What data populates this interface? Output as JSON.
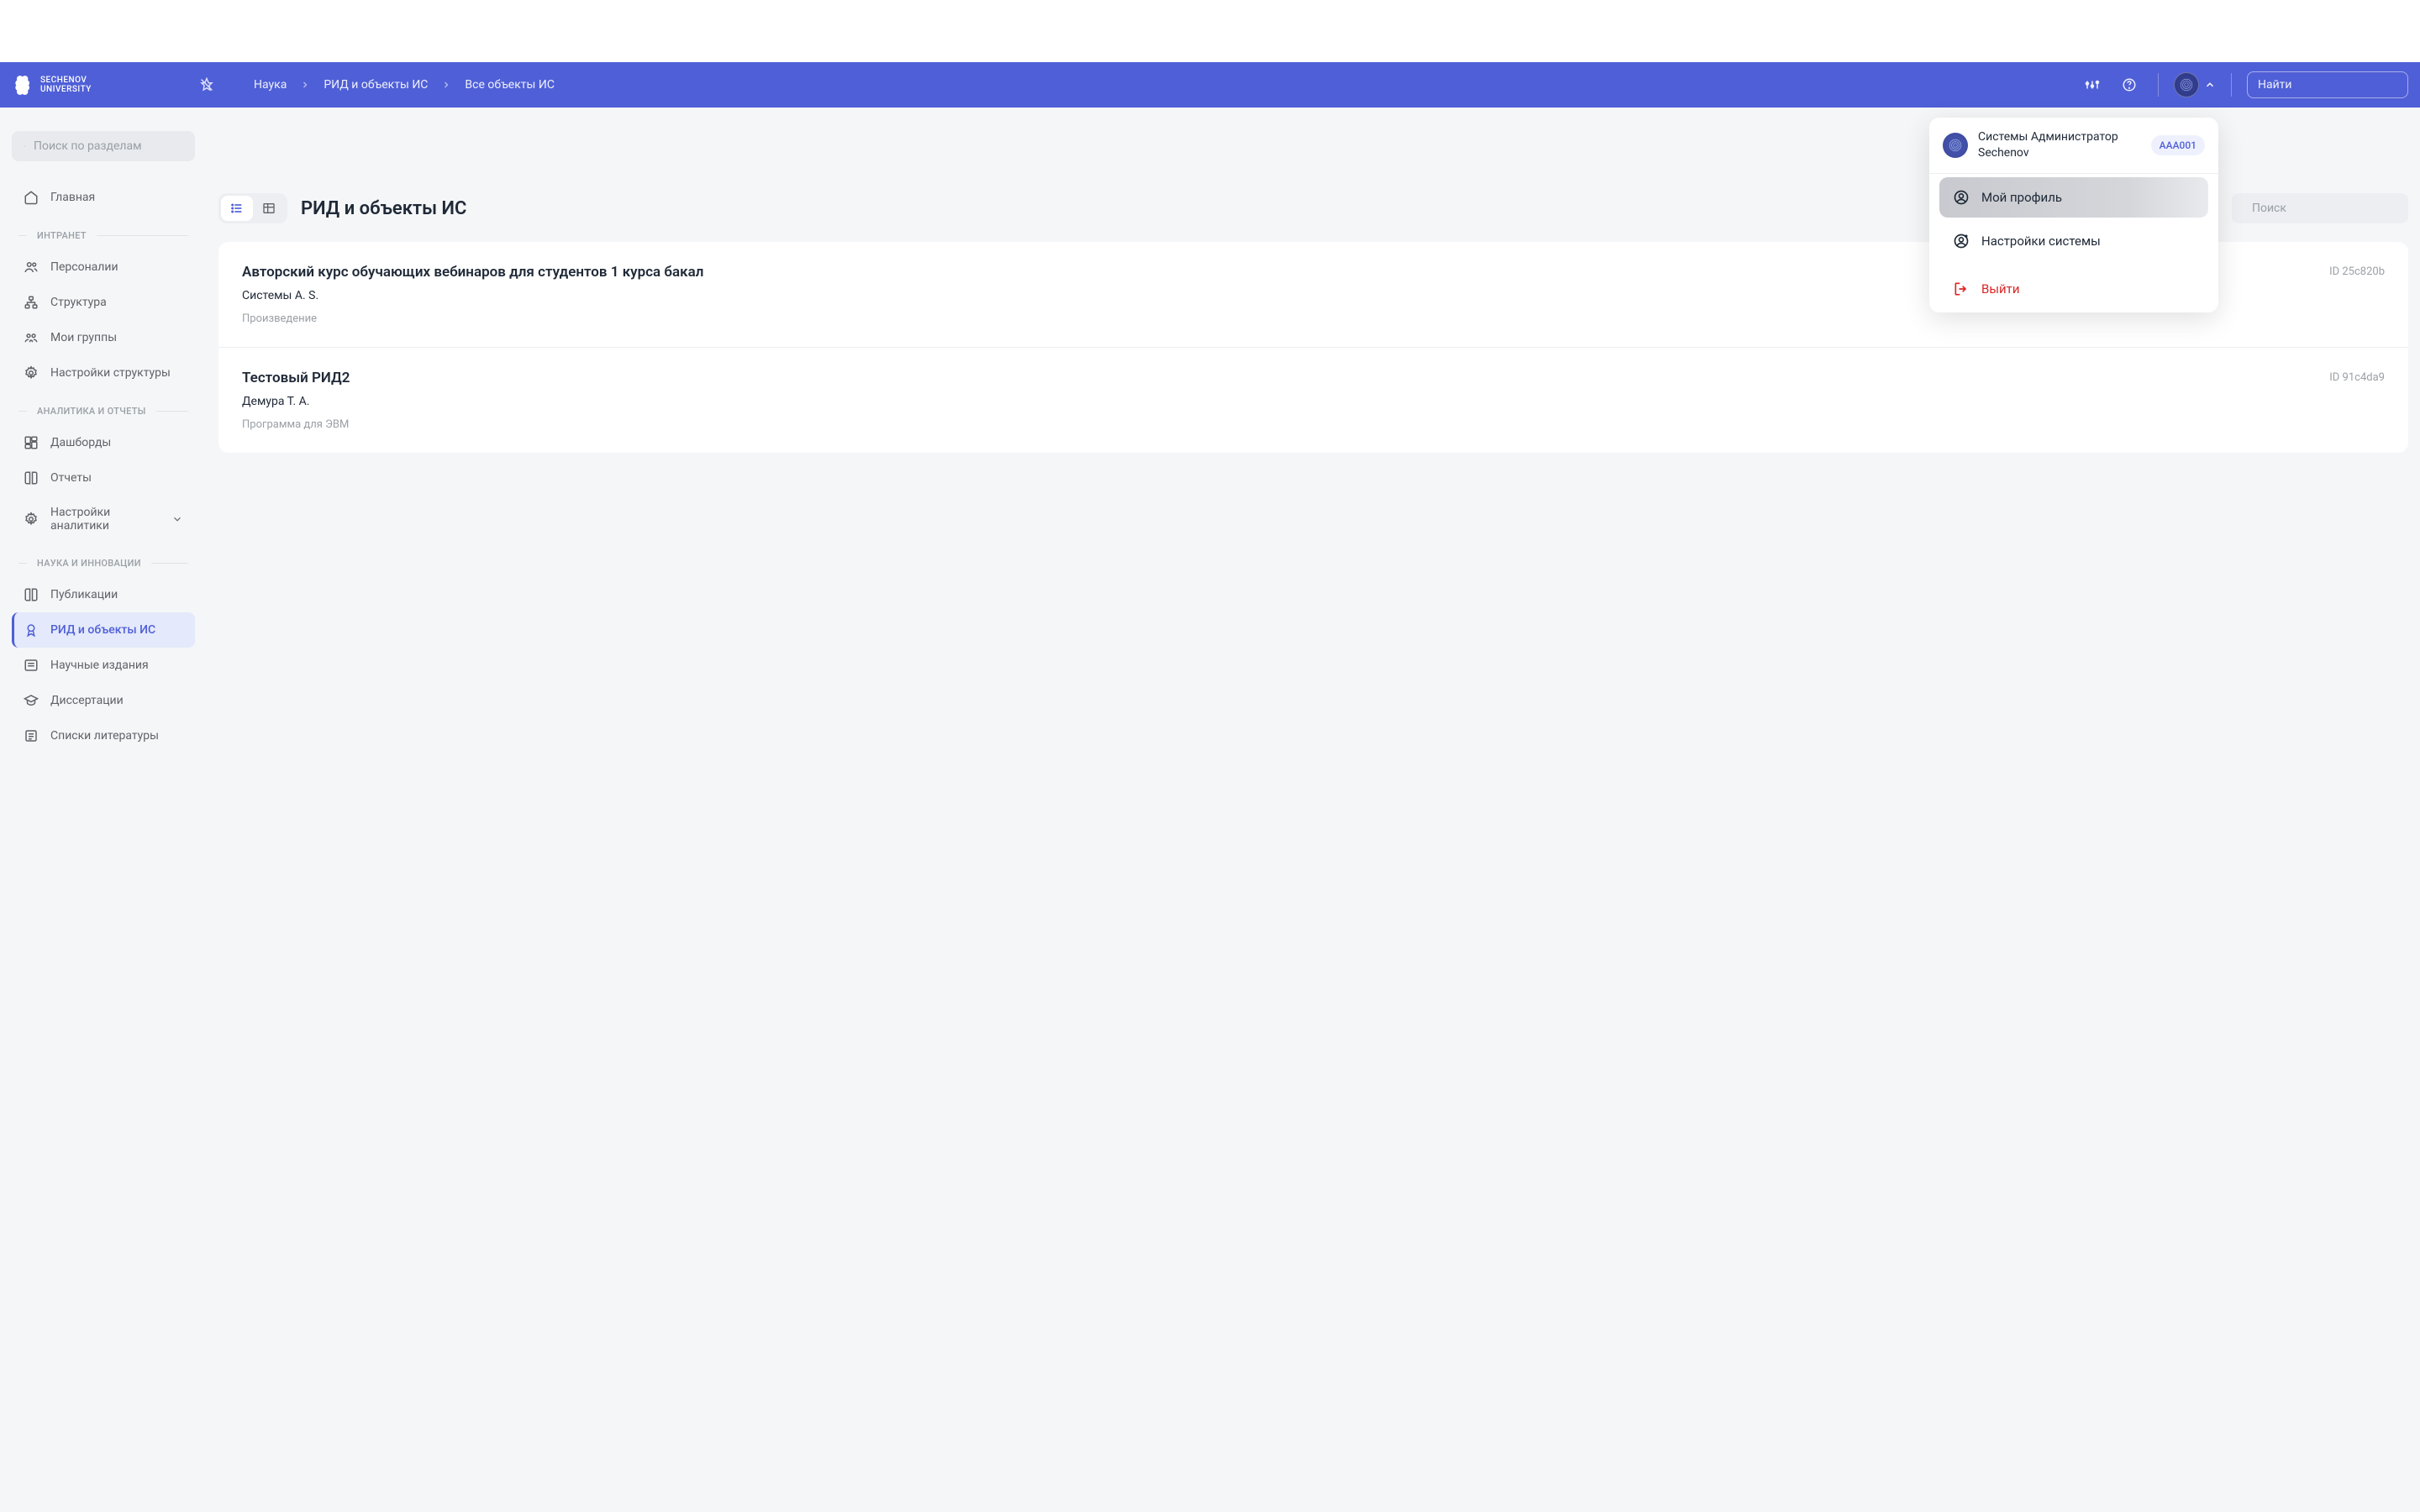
{
  "brand": {
    "line1": "SECHENOV",
    "line2": "UNIVERSITY"
  },
  "breadcrumb": {
    "a": "Наука",
    "b": "РИД и объекты ИС",
    "c": "Все объекты ИС"
  },
  "topsearch": {
    "placeholder": "Найти"
  },
  "sidebar": {
    "search_placeholder": "Поиск по разделам",
    "home": "Главная",
    "sec_intranet": "ИНТРАНЕТ",
    "personalii": "Персоналии",
    "struktura": "Структура",
    "groups": "Мои группы",
    "struct_settings": "Настройки структуры",
    "sec_analytics": "АНАЛИТИКА И ОТЧЕТЫ",
    "dashboards": "Дашборды",
    "reports": "Отчеты",
    "analytics_settings": "Настройки аналитики",
    "sec_science": "НАУКА И ИННОВАЦИИ",
    "publications": "Публикации",
    "rid": "РИД и объекты ИС",
    "journals": "Научные издания",
    "dissertations": "Диссертации",
    "bibliography": "Списки литературы"
  },
  "main": {
    "title": "РИД и объекты ИС",
    "search_placeholder": "Поиск",
    "items": [
      {
        "title": "Авторский курс обучающих вебинаров для студентов 1 курса бакал",
        "author": "Системы А. S.",
        "type": "Произведение",
        "id": "ID 25c820b"
      },
      {
        "title": "Тестовый РИД2",
        "author": "Демура Т. А.",
        "type": "Программа для ЭВМ",
        "id": "ID 91c4da9"
      }
    ]
  },
  "dropdown": {
    "name": "Системы Администратор Sechenov",
    "badge": "AAA001",
    "profile": "Мой профиль",
    "settings": "Настройки системы",
    "logout": "Выйти"
  }
}
